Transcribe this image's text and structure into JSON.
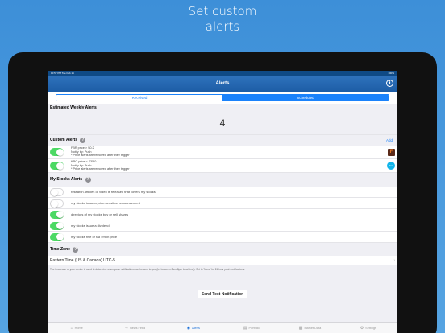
{
  "headline": {
    "line1": "Set custom",
    "line2": "alerts"
  },
  "statusbar": {
    "left": "10:57 PM   Tue Feb 16",
    "right": "100%"
  },
  "nav": {
    "title": "Alerts",
    "info_icon": "i"
  },
  "segment": {
    "received": "Received",
    "scheduled": "Scheduled",
    "selected": "Scheduled"
  },
  "weekly": {
    "label": "Estimated Weekly Alerts",
    "count": "4"
  },
  "custom_alerts": {
    "label": "Custom Alerts",
    "add": "Add",
    "help": "?",
    "items": [
      {
        "line1": "FBR price > $0.2",
        "line2": "Notify by: Push",
        "line3": "* Price alerts are removed after they trigger",
        "on": true,
        "thumb": "F"
      },
      {
        "line1": "KRO price < $35.0",
        "line2": "Notify by: Push",
        "line3": "* Price alerts are removed after they trigger",
        "on": true,
        "thumb": "kro"
      }
    ]
  },
  "my_stocks_alerts": {
    "label": "My Stocks Alerts",
    "help": "?",
    "items": [
      {
        "text": "research articles or video is released that covers my stocks",
        "on": false
      },
      {
        "text": "my stocks issue a price-sensitive announcement",
        "on": false
      },
      {
        "text": "directors of my stocks buy or sell shares",
        "on": true
      },
      {
        "text": "my stocks issue a dividend",
        "on": true
      },
      {
        "text": "my stocks rise or fall 5% in price",
        "on": true
      }
    ]
  },
  "timezone": {
    "label": "Time Zone",
    "help": "?",
    "value": "Eastern Time (US & Canada) UTC-5",
    "note": "The time zone of your device is used to determine when push notifications can be sent to you (ie. between 8am-8pm local time). Set to 'None' for 24 hour push notifications."
  },
  "test_button": "Send Test Notification",
  "tabs": [
    {
      "label": "Home",
      "icon": "home-icon",
      "active": false
    },
    {
      "label": "News Feed",
      "icon": "news-feed-icon",
      "active": false
    },
    {
      "label": "Alerts",
      "icon": "alerts-icon",
      "active": true
    },
    {
      "label": "Portfolio",
      "icon": "portfolio-icon",
      "active": false
    },
    {
      "label": "Market Data",
      "icon": "market-data-icon",
      "active": false
    },
    {
      "label": "Settings",
      "icon": "settings-icon",
      "active": false
    }
  ],
  "colors": {
    "accent": "#1a82fb",
    "toggle_on": "#4cd964",
    "navbar": "#1d5da6",
    "background": "#3d8fd8"
  }
}
